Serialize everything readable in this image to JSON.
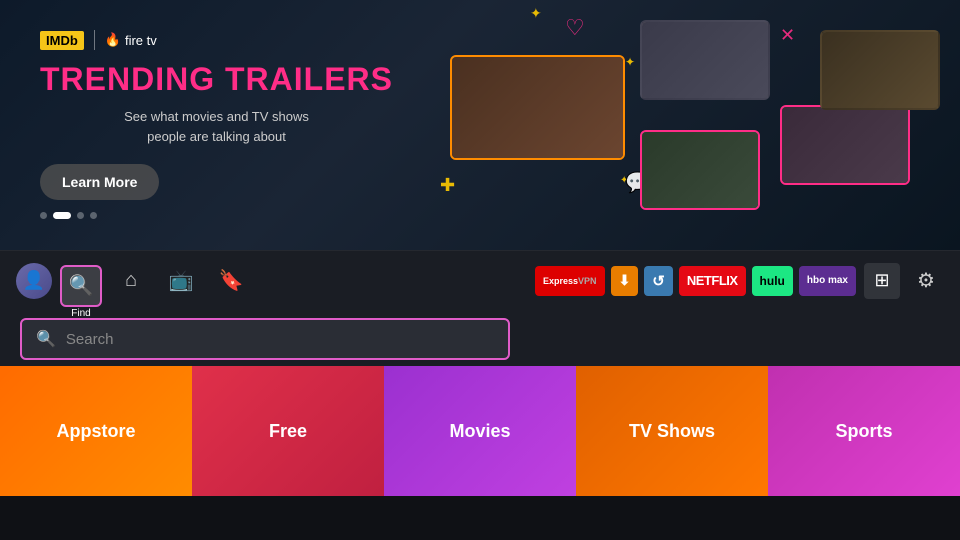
{
  "hero": {
    "imdb_label": "IMDb",
    "firetv_label": "fire tv",
    "title": "TRENDING TRAILERS",
    "subtitle_line1": "See what movies and TV shows",
    "subtitle_line2": "people are talking about",
    "learn_more_label": "Learn More"
  },
  "navbar": {
    "find_label": "Find",
    "nav_items": [
      {
        "id": "home",
        "icon": "⌂",
        "label": ""
      },
      {
        "id": "tv",
        "icon": "⬛",
        "label": ""
      },
      {
        "id": "bookmark",
        "icon": "🔖",
        "label": ""
      }
    ],
    "apps": [
      {
        "id": "expressvpn",
        "label": "ExpressVPN"
      },
      {
        "id": "downloader",
        "label": "⬇"
      },
      {
        "id": "sync",
        "label": "↺"
      },
      {
        "id": "netflix",
        "label": "NETFLIX"
      },
      {
        "id": "hulu",
        "label": "hulu"
      },
      {
        "id": "hbomax",
        "label": "hbo max"
      }
    ]
  },
  "search": {
    "placeholder": "Search"
  },
  "categories": [
    {
      "id": "appstore",
      "label": "Appstore"
    },
    {
      "id": "free",
      "label": "Free"
    },
    {
      "id": "movies",
      "label": "Movies"
    },
    {
      "id": "tvshows",
      "label": "TV Shows"
    },
    {
      "id": "sports",
      "label": "Sports"
    }
  ],
  "dots": [
    {
      "active": false
    },
    {
      "active": true
    },
    {
      "active": false
    },
    {
      "active": false
    }
  ],
  "colors": {
    "accent_pink": "#ff2d87",
    "accent_orange": "#ff6b00",
    "nav_bg": "#1a1d24",
    "hero_bg": "#0d1a2a"
  }
}
